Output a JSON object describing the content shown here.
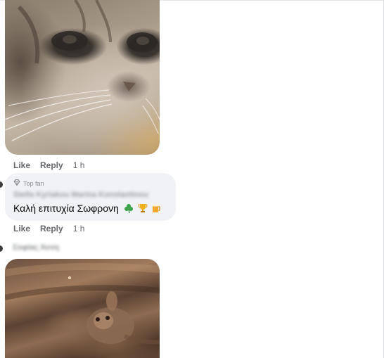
{
  "comment_1": {
    "media_alt_icon": "cat-gif",
    "like_label": "Like",
    "reply_label": "Reply",
    "timestamp": "1 h"
  },
  "comment_2": {
    "badge_icon": "diamond-icon",
    "badge_label": "Top fan",
    "commenter_name": "Stella Kyriakou Marina Konstantinou",
    "text": "Καλή επιτυχία Σωφρονη",
    "emojis": [
      "shamrock",
      "trophy",
      "beer-mug"
    ],
    "like_label": "Like",
    "reply_label": "Reply",
    "timestamp": "1 h"
  },
  "comment_3": {
    "commenter_name": "Σοφίας Άννη",
    "media_alt_icon": "mouse-gif"
  },
  "colors": {
    "meta_text": "#65676b",
    "bubble_bg": "#f0f2f5",
    "text": "#050505"
  }
}
